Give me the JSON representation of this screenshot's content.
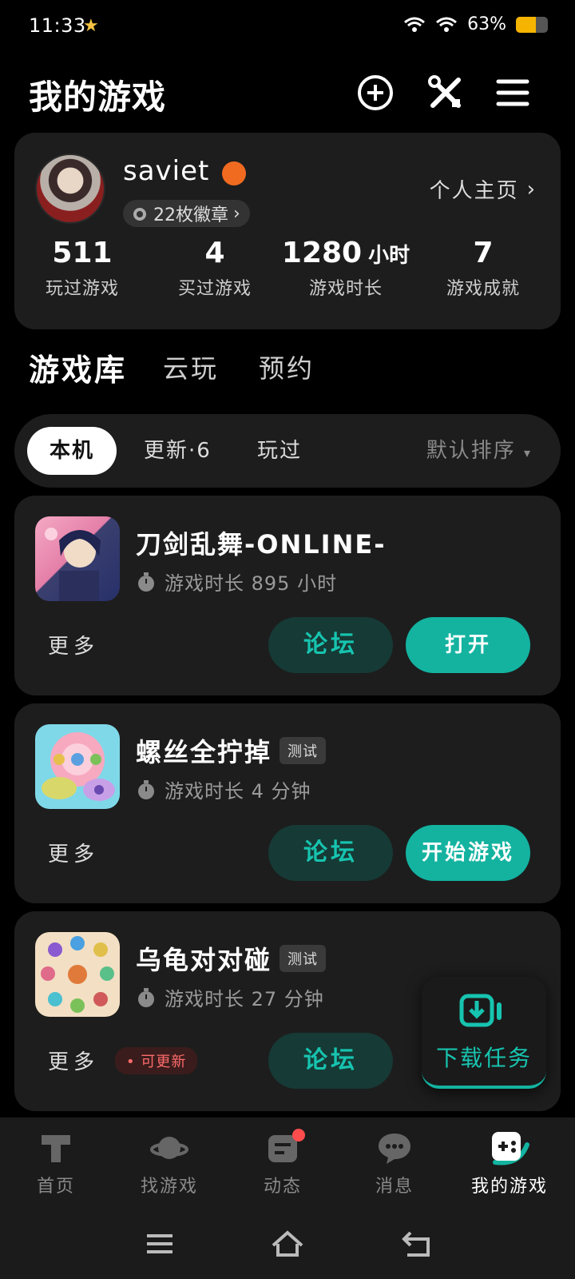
{
  "status_bar": {
    "time": "11:33",
    "battery_text": "63%",
    "battery_level": 0.63
  },
  "header": {
    "title": "我的游戏"
  },
  "profile": {
    "username": "saviet",
    "badges_label": "22枚徽章",
    "homepage_label": "个人主页",
    "stats": [
      {
        "value": "511",
        "unit": "",
        "label": "玩过游戏"
      },
      {
        "value": "4",
        "unit": "",
        "label": "买过游戏"
      },
      {
        "value": "1280",
        "unit": "小时",
        "label": "游戏时长"
      },
      {
        "value": "7",
        "unit": "",
        "label": "游戏成就"
      }
    ]
  },
  "library_tabs": [
    "游戏库",
    "云玩",
    "预约"
  ],
  "filter": {
    "chips": [
      "本机",
      "更新·6",
      "玩过"
    ],
    "sort_label": "默认排序"
  },
  "games": [
    {
      "name": "刀剑乱舞-ONLINE-",
      "tag": "",
      "playtime": "游戏时长 895 小时",
      "more_label": "更多",
      "update_label": "",
      "forum_label": "论坛",
      "action_label": "打开"
    },
    {
      "name": "螺丝全拧掉",
      "tag": "测试",
      "playtime": "游戏时长 4 分钟",
      "more_label": "更多",
      "update_label": "",
      "forum_label": "论坛",
      "action_label": "开始游戏"
    },
    {
      "name": "乌龟对对碰",
      "tag": "测试",
      "playtime": "游戏时长 27 分钟",
      "more_label": "更多",
      "update_label": "可更新",
      "forum_label": "论坛",
      "action_label": ""
    }
  ],
  "download_float": {
    "label": "下载任务"
  },
  "bottom_nav": [
    {
      "label": "首页",
      "icon": "home-icon"
    },
    {
      "label": "找游戏",
      "icon": "planet-icon"
    },
    {
      "label": "动态",
      "icon": "feed-icon"
    },
    {
      "label": "消息",
      "icon": "chat-icon"
    },
    {
      "label": "我的游戏",
      "icon": "gamepad-icon"
    }
  ],
  "colors": {
    "accent": "#13b3a0",
    "card": "#1d1d1d",
    "background": "#000000"
  }
}
